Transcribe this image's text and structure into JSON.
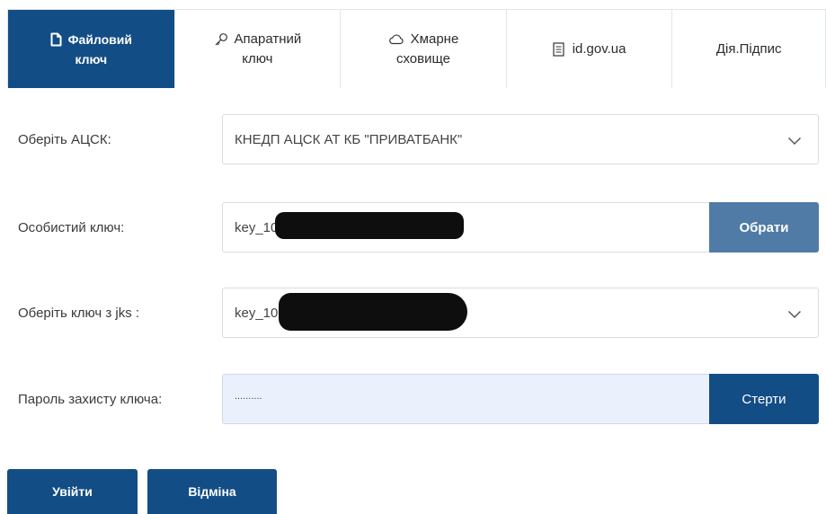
{
  "tabs": [
    {
      "line1": "Файловий",
      "line2": "ключ",
      "icon": "file-icon"
    },
    {
      "line1": "Апаратний",
      "line2": "ключ",
      "icon": "key-icon"
    },
    {
      "line1": "Хмарне",
      "line2": "сховище",
      "icon": "cloud-icon"
    },
    {
      "line1": "id.gov.ua",
      "icon": "document-icon"
    },
    {
      "line1": "Дія.Підпис"
    }
  ],
  "form": {
    "acsk_label": "Оберіть АЦСК:",
    "acsk_value": "КНЕДП АЦСК АТ КБ \"ПРИВАТБАНК\"",
    "key_label": "Особистий ключ:",
    "key_value": "key_1005389206_1005389206.jks",
    "choose_button": "Обрати",
    "jks_label": "Оберіть ключ з jks :",
    "jks_value": "key_1005389206_1005389206",
    "password_label": "Пароль захисту ключа:",
    "password_value": "..........",
    "erase_button": "Стерти"
  },
  "actions": {
    "login_button": "Увійти",
    "cancel_button": "Відміна"
  },
  "colors": {
    "primary": "#134d85",
    "secondary_button": "#4f7ba6",
    "password_field_bg": "#eaf1fc"
  }
}
